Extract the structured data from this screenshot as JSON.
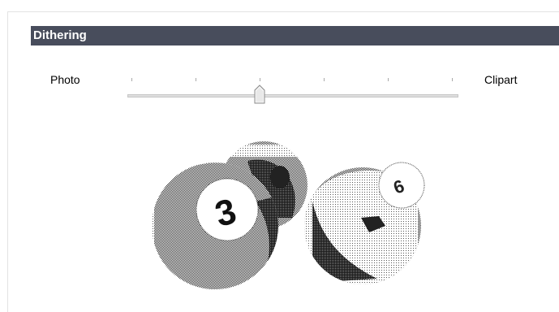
{
  "section": {
    "title": "Dithering"
  },
  "slider": {
    "left_label": "Photo",
    "right_label": "Clipart",
    "value": 2,
    "min": 0,
    "max": 5,
    "tick_count": 6
  },
  "preview": {
    "ball_numbers": [
      "3",
      "6"
    ]
  },
  "colors": {
    "header_bg": "#484d5c",
    "header_text": "#ffffff"
  }
}
